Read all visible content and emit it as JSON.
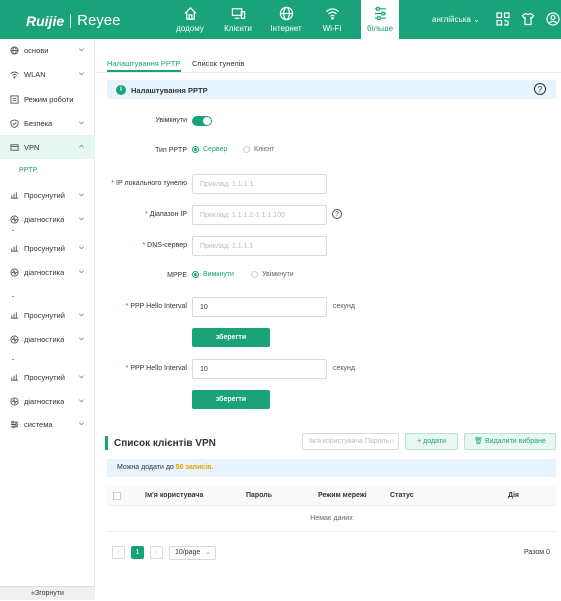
{
  "brand": {
    "logo_a": "Ruijie",
    "logo_b": "Reyee"
  },
  "topnav": [
    {
      "label": "додому",
      "icon": "home-icon"
    },
    {
      "label": "Клієнти",
      "icon": "devices-icon"
    },
    {
      "label": "Інтернет",
      "icon": "globe-icon"
    },
    {
      "label": "Wi-Fi",
      "icon": "wifi-icon"
    },
    {
      "label": "більше",
      "icon": "settings-sliders-icon",
      "active": true
    }
  ],
  "language": "англійська",
  "sidebar": {
    "items": [
      {
        "label": "основи",
        "icon": "globe-icon"
      },
      {
        "label": "WLAN",
        "icon": "wifi-icon"
      },
      {
        "label": "Режим роботи",
        "icon": "mode-icon"
      },
      {
        "label": "Безпека",
        "icon": "shield-icon"
      },
      {
        "label": "VPN",
        "icon": "vpn-icon",
        "active": true
      },
      {
        "label": "Просунутий",
        "icon": "advanced-icon"
      },
      {
        "label": "діагностика",
        "icon": "diagnostics-icon"
      },
      {
        "label": "Просунутий",
        "icon": "advanced-icon"
      },
      {
        "label": "діагностика",
        "icon": "diagnostics-icon"
      },
      {
        "label": "Просунутий",
        "icon": "advanced-icon"
      },
      {
        "label": "діагностика",
        "icon": "diagnostics-icon"
      },
      {
        "label": "Просунутий",
        "icon": "advanced-icon"
      },
      {
        "label": "діагностика",
        "icon": "diagnostics-icon"
      },
      {
        "label": "система",
        "icon": "system-icon"
      }
    ],
    "sub_item": "PPTP",
    "collapse": "«Згорнути"
  },
  "tabs": [
    "Налаштування PPTP",
    "Список тунелів"
  ],
  "panel_title": "Налаштування PPTP",
  "form": {
    "enable_label": "Увімкнути",
    "pptp_type_label": "Тип PPTP",
    "type_server": "Сервер",
    "type_client": "Клієнт",
    "local_ip_label": "IP локального тунелю",
    "local_ip_placeholder": "Приклад: 1.1.1.1",
    "ip_range_label": "Діапазон IP",
    "ip_range_placeholder": "Приклад: 1.1.1.2-1.1.1.100",
    "dns_label": "DNS-сервер",
    "dns_placeholder": "Приклад: 1.1.1.1",
    "mppe_label": "MPPE",
    "mppe_off": "Вимкнути",
    "mppe_on": "Увімкнути",
    "hello_label": "PPP Hello Interval",
    "hello_value": "10",
    "unit": "секунд",
    "save": "зберегти",
    "hello_label2": "PPP Hello Interval",
    "hello_value2": "10",
    "unit2": "секунд",
    "save2": "зберегти"
  },
  "client_list": {
    "title": "Список клієнтів VPN",
    "search_placeholder": "Ім'я користувача Пароль",
    "add": "+ додати",
    "delete": "Видалити вибране",
    "notice_prefix": "Можна додати до",
    "notice_count": "50 записів.",
    "columns": [
      "Ім'я користувача",
      "Пароль",
      "Режим мережі",
      "Статус",
      "Дія"
    ],
    "empty": "Немає даних",
    "page": "1",
    "page_size": "10/page",
    "total": "Разом 0"
  },
  "colors": {
    "accent": "#1aa37a",
    "info_bg": "#e8f4fd"
  }
}
